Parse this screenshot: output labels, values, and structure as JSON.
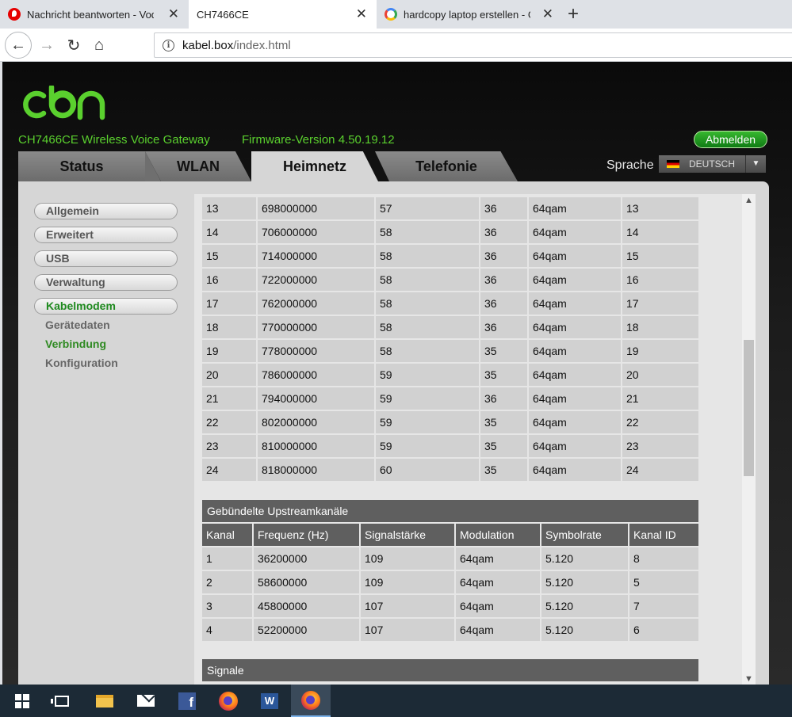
{
  "browser": {
    "tabs": [
      {
        "title": "Nachricht beantworten - Vodafone",
        "active": false
      },
      {
        "title": "CH7466CE",
        "active": true
      },
      {
        "title": "hardcopy laptop erstellen - Google",
        "active": false
      }
    ],
    "url_host": "kabel.box",
    "url_path": "/index.html"
  },
  "router": {
    "logo": "cbn",
    "device_title": "CH7466CE  Wireless Voice Gateway",
    "firmware": "Firmware-Version  4.50.19.12",
    "logout_label": "Abmelden",
    "main_tabs": [
      "Status",
      "WLAN",
      "Heimnetz",
      "Telefonie"
    ],
    "active_tab": "Heimnetz",
    "language_label": "Sprache",
    "language_value": "DEUTSCH",
    "sidebar": {
      "items": [
        "Allgemein",
        "Erweitert",
        "USB",
        "Verwaltung",
        "Kabelmodem"
      ],
      "active_item": "Kabelmodem",
      "sub_items": [
        "Gerätedaten",
        "Verbindung",
        "Konfiguration"
      ],
      "active_sub_item": "Verbindung"
    },
    "downstream_rows": [
      [
        "13",
        "698000000",
        "57",
        "36",
        "64qam",
        "13"
      ],
      [
        "14",
        "706000000",
        "58",
        "36",
        "64qam",
        "14"
      ],
      [
        "15",
        "714000000",
        "58",
        "36",
        "64qam",
        "15"
      ],
      [
        "16",
        "722000000",
        "58",
        "36",
        "64qam",
        "16"
      ],
      [
        "17",
        "762000000",
        "58",
        "36",
        "64qam",
        "17"
      ],
      [
        "18",
        "770000000",
        "58",
        "36",
        "64qam",
        "18"
      ],
      [
        "19",
        "778000000",
        "58",
        "35",
        "64qam",
        "19"
      ],
      [
        "20",
        "786000000",
        "59",
        "35",
        "64qam",
        "20"
      ],
      [
        "21",
        "794000000",
        "59",
        "36",
        "64qam",
        "21"
      ],
      [
        "22",
        "802000000",
        "59",
        "35",
        "64qam",
        "22"
      ],
      [
        "23",
        "810000000",
        "59",
        "35",
        "64qam",
        "23"
      ],
      [
        "24",
        "818000000",
        "60",
        "35",
        "64qam",
        "24"
      ]
    ],
    "upstream": {
      "title": "Gebündelte Upstreamkanäle",
      "headers": [
        "Kanal",
        "Frequenz (Hz)",
        "Signalstärke",
        "Modulation",
        "Symbolrate",
        "Kanal ID"
      ],
      "rows": [
        [
          "1",
          "36200000",
          "109",
          "64qam",
          "5.120",
          "8"
        ],
        [
          "2",
          "58600000",
          "109",
          "64qam",
          "5.120",
          "5"
        ],
        [
          "3",
          "45800000",
          "107",
          "64qam",
          "5.120",
          "7"
        ],
        [
          "4",
          "52200000",
          "107",
          "64qam",
          "5.120",
          "6"
        ]
      ]
    },
    "signals_title": "Signale"
  }
}
